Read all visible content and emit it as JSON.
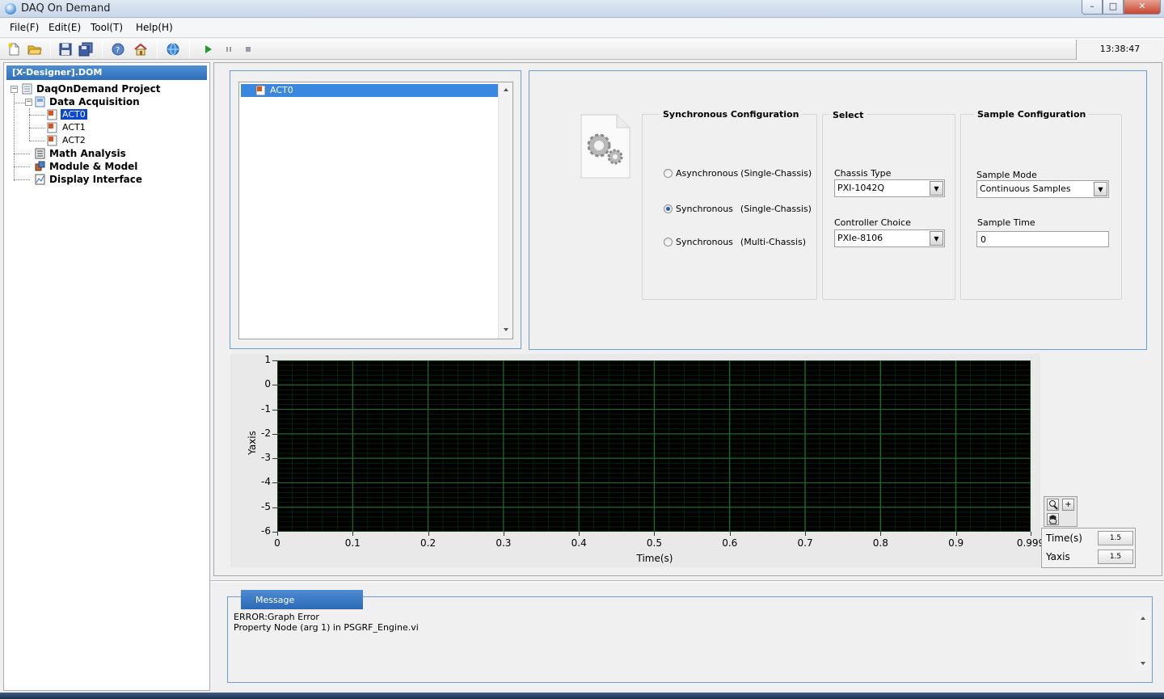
{
  "window": {
    "title": "DAQ On Demand",
    "controls": {
      "minimize": "–",
      "maximize": "□",
      "close": "✕"
    }
  },
  "menu": [
    "File(F)",
    "Edit(E)",
    "Tool(T)",
    "Help(H)"
  ],
  "toolbar": {
    "icons": [
      "new-file-icon",
      "open-folder-icon",
      "save-icon",
      "save-all-icon",
      "help-icon",
      "home-icon",
      "globe-icon",
      "run-icon",
      "pause-icon",
      "stop-icon"
    ],
    "clock": "13:38:47"
  },
  "tree": {
    "header": "[X-Designer].DOM",
    "root": "DaqOnDemand Project",
    "data_acquisition": "Data Acquisition",
    "channels": [
      "ACT0",
      "ACT1",
      "ACT2"
    ],
    "math_analysis": "Math Analysis",
    "module_model": "Module & Model",
    "display_interface": "Display Interface"
  },
  "device_list": {
    "items": [
      "ACT0"
    ]
  },
  "sync_config": {
    "title": "Synchronous Configuration",
    "options": [
      {
        "label": "Asynchronous",
        "suffix": "(Single-Chassis)"
      },
      {
        "label": "Synchronous",
        "suffix": "(Single-Chassis)"
      },
      {
        "label": "Synchronous",
        "suffix": "(Multi-Chassis)"
      }
    ],
    "selected_index": 1
  },
  "select": {
    "title": "Select",
    "chassis_type_label": "Chassis Type",
    "chassis_type_value": "PXI-1042Q",
    "controller_label": "Controller Choice",
    "controller_value": "PXIe-8106"
  },
  "sample_config": {
    "title": "Sample Configuration",
    "mode_label": "Sample Mode",
    "mode_value": "Continuous Samples",
    "time_label": "Sample Time",
    "time_value": "0"
  },
  "graph": {
    "xlabel": "Time(s)",
    "ylabel": "Yaxis",
    "x_ticks": [
      "0",
      "0.1",
      "0.2",
      "0.3",
      "0.4",
      "0.5",
      "0.6",
      "0.7",
      "0.8",
      "0.9",
      "0.999"
    ],
    "y_ticks": [
      "1",
      "0",
      "-1",
      "-2",
      "-3",
      "-4",
      "-5",
      "-6"
    ],
    "xlim": [
      0,
      0.999
    ],
    "ylim": [
      -6,
      1
    ],
    "grid": true,
    "grid_color": "#1f6b2a",
    "plot_bg": "#000000",
    "scales": [
      {
        "name": "Time(s)",
        "format": "1.5"
      },
      {
        "name": "Yaxis",
        "format": "1.5"
      }
    ]
  },
  "message": {
    "tab": "Message",
    "lines": [
      "ERROR:Graph Error",
      "Property Node (arg 1) in PSGRF_Engine.vi"
    ]
  },
  "colors": {
    "accent": "#2f6fbb",
    "selection": "#0a46d6",
    "frame_border": "#6d9dd5"
  }
}
